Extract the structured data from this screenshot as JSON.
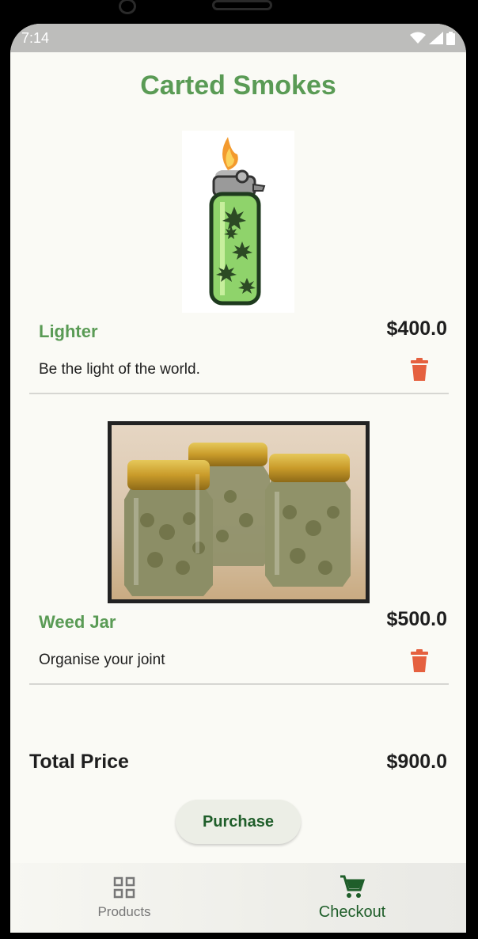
{
  "status_bar": {
    "time": "7:14"
  },
  "header": {
    "title": "Carted Smokes"
  },
  "cart": {
    "items": [
      {
        "name": "Lighter",
        "price": "$400.0",
        "description": "Be the light of the world."
      },
      {
        "name": "Weed Jar",
        "price": "$500.0",
        "description": "Organise your joint"
      }
    ]
  },
  "summary": {
    "total_label": "Total Price",
    "total_value": "$900.0"
  },
  "actions": {
    "purchase_label": "Purchase"
  },
  "bottom_nav": {
    "items": [
      {
        "label": "Products",
        "icon": "grid-icon",
        "active": false
      },
      {
        "label": "Checkout",
        "icon": "cart-icon",
        "active": true
      }
    ]
  },
  "colors": {
    "accent_green": "#5a9b55",
    "dark_green": "#1f5e2a",
    "delete_red": "#e5603f",
    "background": "#fafaf5"
  }
}
